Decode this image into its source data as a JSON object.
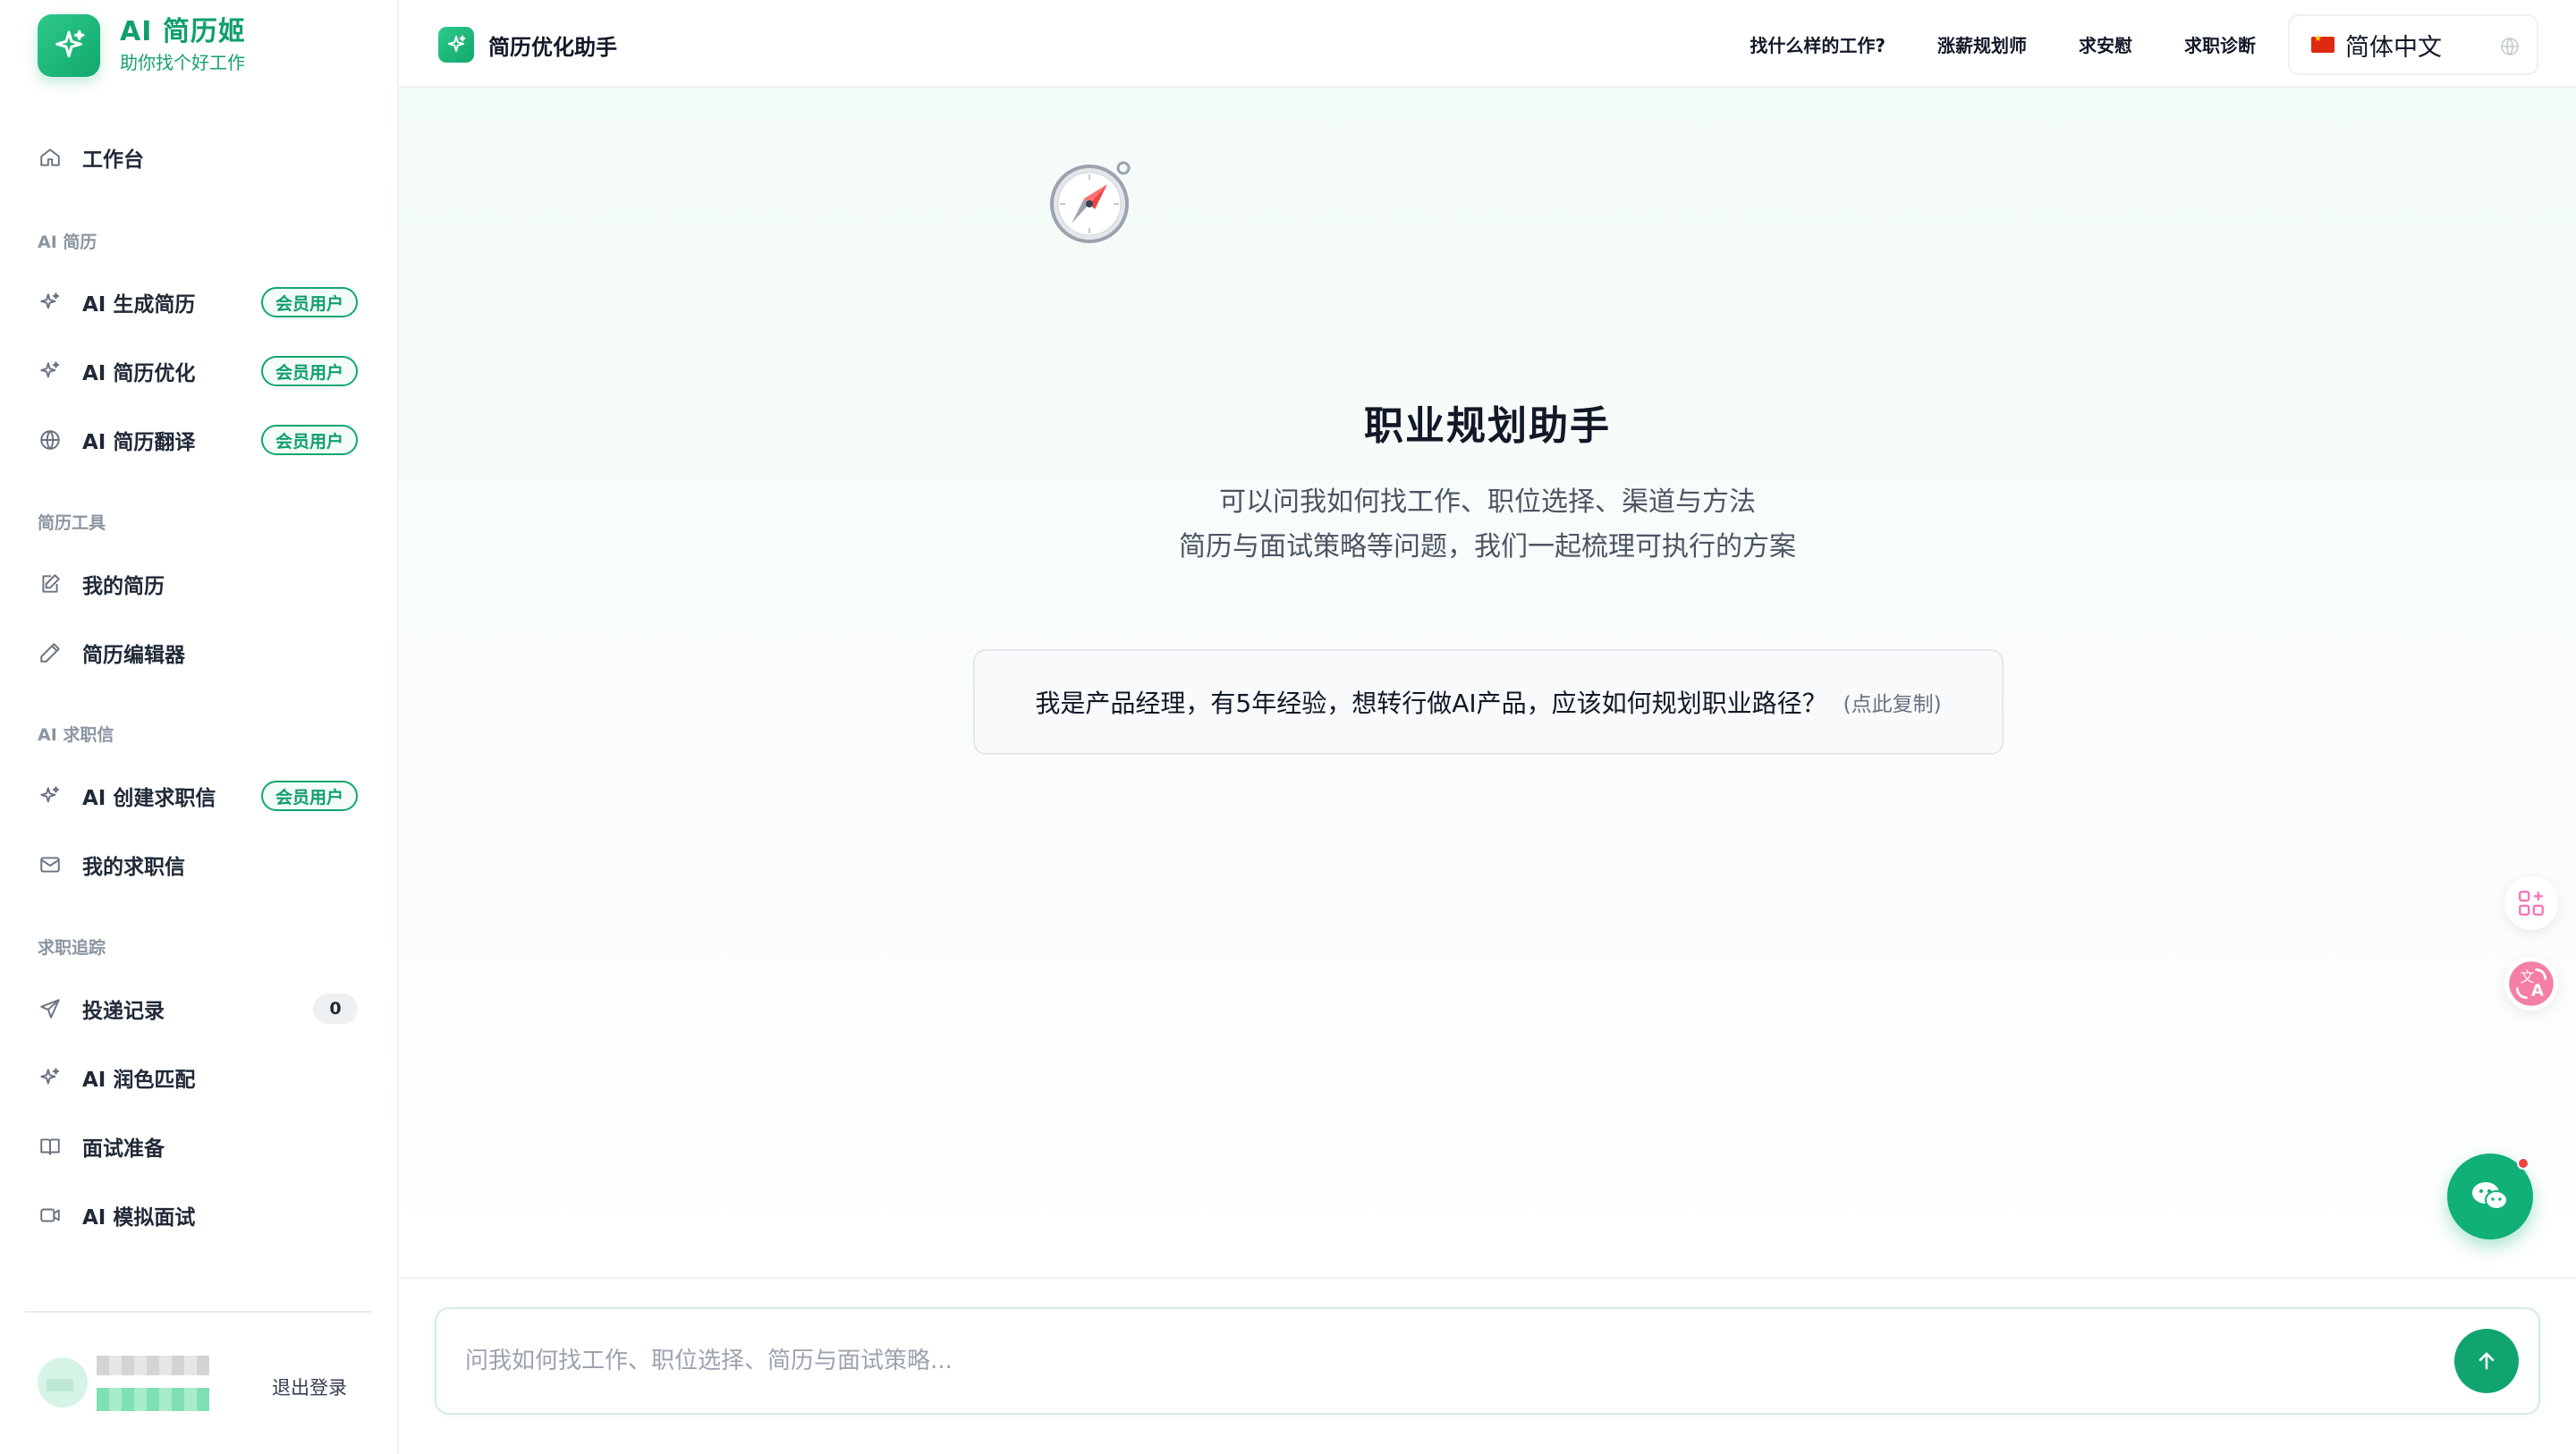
{
  "brand": {
    "title": "AI 简历姬",
    "subtitle": "助你找个好工作"
  },
  "sidebar": {
    "workbench": "工作台",
    "sections": {
      "ai_resume": "AI 简历",
      "resume_tools": "简历工具",
      "ai_cover": "AI 求职信",
      "job_track": "求职追踪"
    },
    "items": {
      "gen": {
        "label": "AI 生成简历",
        "badge": "会员用户"
      },
      "optimize": {
        "label": "AI 简历优化",
        "badge": "会员用户"
      },
      "translate": {
        "label": "AI 简历翻译",
        "badge": "会员用户"
      },
      "my_resume": {
        "label": "我的简历"
      },
      "editor": {
        "label": "简历编辑器"
      },
      "cover_create": {
        "label": "AI 创建求职信",
        "badge": "会员用户"
      },
      "my_cover": {
        "label": "我的求职信"
      },
      "delivery": {
        "label": "投递记录",
        "count": "0"
      },
      "polish": {
        "label": "AI 润色匹配"
      },
      "interview_prep": {
        "label": "面试准备"
      },
      "mock": {
        "label": "AI 模拟面试"
      }
    },
    "logout": "退出登录"
  },
  "header": {
    "title": "简历优化助手",
    "links": [
      "找什么样的工作?",
      "涨薪规划师",
      "求安慰",
      "求职诊断"
    ],
    "language": "简体中文"
  },
  "main": {
    "title": "职业规划助手",
    "line1": "可以问我如何找工作、职位选择、渠道与方法",
    "line2": "简历与面试策略等问题，我们一起梳理可执行的方案",
    "prompt": "我是产品经理，有5年经验，想转行做AI产品，应该如何规划职业路径？",
    "prompt_hint": "(点此复制)"
  },
  "composer": {
    "placeholder": "问我如何找工作、职位选择、简历与面试策略..."
  },
  "colors": {
    "brand": "#10a86d",
    "accent_dark": "#0f9f6b",
    "notify": "#ef4444"
  }
}
